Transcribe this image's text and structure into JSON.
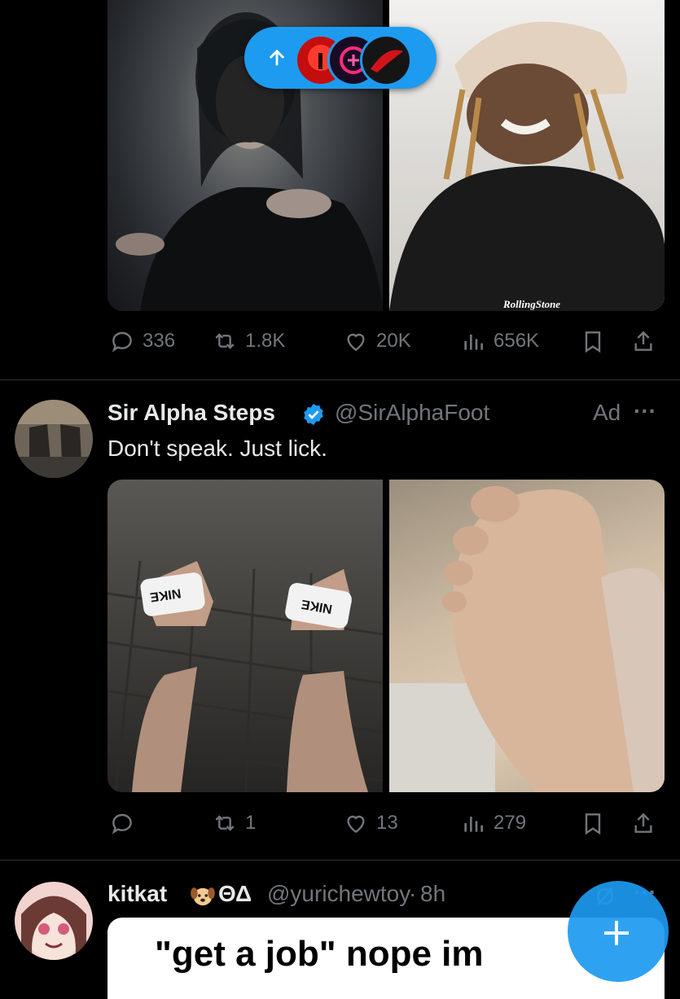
{
  "new_posts_pill": {
    "arrow_icon": "arrow-up-icon",
    "avatars": [
      "red-avatar",
      "neon-logo-avatar",
      "dark-red-avatar"
    ]
  },
  "post1": {
    "media": [
      {
        "desc": "woman-black-turtleneck-photo"
      },
      {
        "desc": "man-beanie-black-sweater-photo",
        "watermark": "RollingStone"
      }
    ],
    "replies": "336",
    "reposts": "1.8K",
    "likes": "20K",
    "views": "656K"
  },
  "post2": {
    "author_name": "Sir Alpha Steps",
    "verified": true,
    "handle": "@SirAlphaFoot",
    "ad_label": "Ad",
    "more_label": "···",
    "text": "Don't speak. Just lick.",
    "media_brand": [
      "NIKE",
      "NIKE"
    ],
    "replies": "",
    "reposts": "1",
    "likes": "13",
    "views": "279"
  },
  "post3": {
    "author_name": "kitkat",
    "name_suffix": "ΘΔ",
    "handle": "@yurichewtoy",
    "separator": "·",
    "time": "8h",
    "more_label": "···",
    "image_caption": "\"get a job\" nope im"
  },
  "colors": {
    "background": "#000000",
    "accent": "#1d9bf0",
    "muted": "#71767b",
    "text": "#e7e9ea",
    "divider": "#2f3336"
  }
}
